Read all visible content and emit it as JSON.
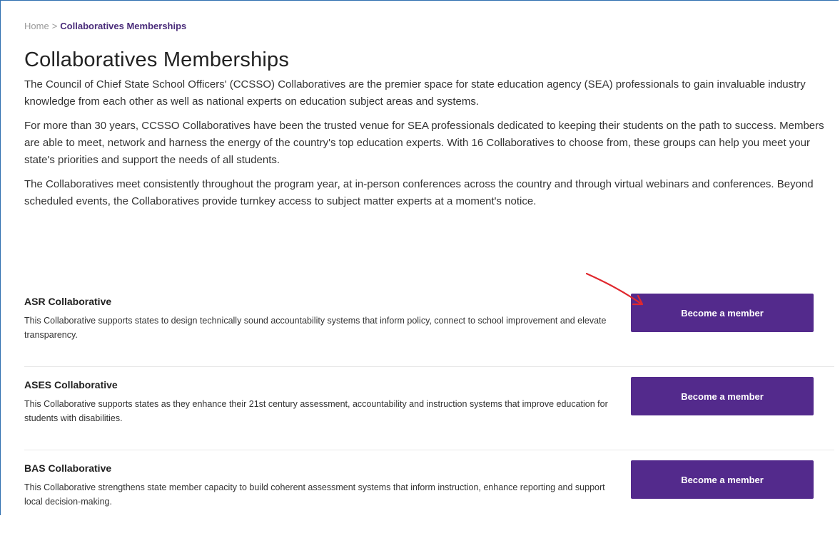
{
  "breadcrumb": {
    "home": "Home",
    "separator": ">",
    "current": "Collaboratives Memberships"
  },
  "page": {
    "title": "Collaboratives Memberships",
    "paragraphs": [
      "The Council of Chief State School Officers' (CCSSO) Collaboratives are the premier space for state education agency (SEA) professionals to gain invaluable industry knowledge from each other as well as national experts on education subject areas and systems.",
      "For more than 30 years, CCSSO Collaboratives have been the trusted venue for SEA professionals dedicated to keeping their students on the path to success. Members are able to meet, network and harness the energy of the country's top education experts. With 16 Collaboratives to choose from, these groups can help you meet your state's priorities and support the needs of all students.",
      "The Collaboratives meet consistently throughout the program year, at in-person conferences across the country and through virtual webinars and conferences. Beyond scheduled events, the Collaboratives provide turnkey access to subject matter experts at a moment's notice."
    ]
  },
  "collaboratives": [
    {
      "name": "ASR Collaborative",
      "description": "This Collaborative supports states to design technically sound accountability systems that inform policy, connect to school improvement and elevate transparency.",
      "button": "Become a member"
    },
    {
      "name": "ASES Collaborative",
      "description": "This Collaborative supports states as they enhance their 21st century assessment, accountability and instruction systems that improve education for students with disabilities.",
      "button": "Become a member"
    },
    {
      "name": "BAS Collaborative",
      "description": "This Collaborative strengthens state member capacity to build coherent assessment systems that inform instruction, enhance reporting and support local decision-making.",
      "button": "Become a member"
    }
  ],
  "colors": {
    "accent": "#532a8c",
    "annotation_arrow": "#e0282e"
  }
}
